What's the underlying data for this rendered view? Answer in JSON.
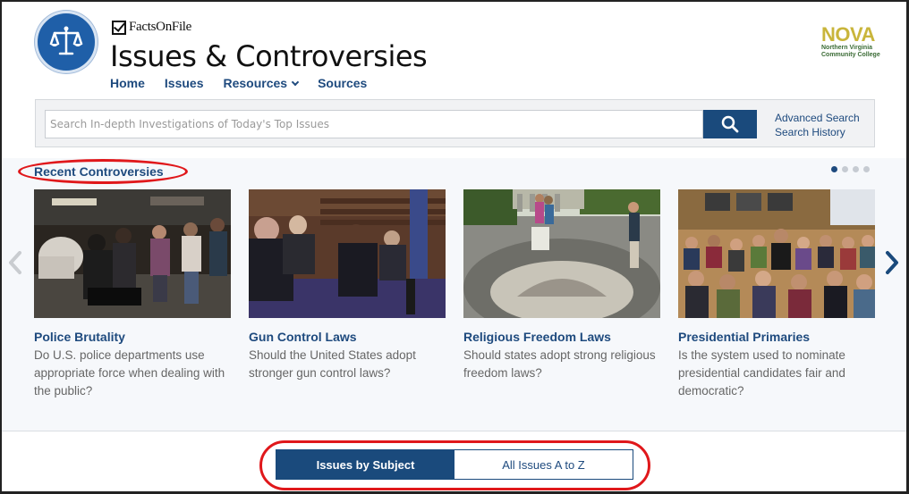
{
  "brand": {
    "publisher": "FactsOnFile",
    "title": "Issues & Controversies",
    "institution_short": "NOVA",
    "institution_line1": "Northern Virginia",
    "institution_line2": "Community College"
  },
  "nav": {
    "items": [
      {
        "label": "Home"
      },
      {
        "label": "Issues"
      },
      {
        "label": "Resources"
      },
      {
        "label": "Sources"
      }
    ]
  },
  "search": {
    "placeholder": "Search In-depth Investigations of Today's Top Issues",
    "advanced_label": "Advanced Search",
    "history_label": "Search History"
  },
  "recent": {
    "title": "Recent Controversies",
    "page_count": 4,
    "active_page": 1,
    "cards": [
      {
        "title": "Police Brutality",
        "question": "Do U.S. police departments use appropriate force when dealing with the public?"
      },
      {
        "title": "Gun Control Laws",
        "question": "Should the United States adopt stronger gun control laws?"
      },
      {
        "title": "Religious Freedom Laws",
        "question": "Should states adopt strong religious freedom laws?"
      },
      {
        "title": "Presidential Primaries",
        "question": "Is the system used to nominate presidential candidates fair and democratic?"
      }
    ]
  },
  "bottom_tabs": {
    "active_label": "Issues by Subject",
    "inactive_label": "All Issues A to Z"
  },
  "colors": {
    "accent": "#1a4a7c",
    "link": "#1e4a7e",
    "highlight": "#e0181b",
    "nova_gold": "#c9b53b",
    "nova_green": "#3a6b35"
  }
}
